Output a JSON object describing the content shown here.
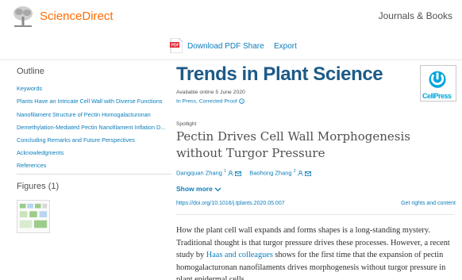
{
  "header": {
    "brand": "ScienceDirect",
    "journals_link": "Journals & Books"
  },
  "toolbar": {
    "download_pdf": "Download PDF",
    "share": "Share",
    "export": "Export"
  },
  "sidebar": {
    "outline_title": "Outline",
    "outline_items": [
      "Keywords",
      "Plants Have an Intricate Cell Wall with Diverse Functions",
      "Nanofilament Structure of Pectin Homogalacturonan",
      "Demethylation-Mediated Pectin Nanofilament Inflation D...",
      "Concluding Remarks and Future Perspectives",
      "Acknowledgments",
      "References"
    ],
    "figures_title": "Figures (1)"
  },
  "article": {
    "journal": "Trends in Plant Science",
    "available": "Available online 5 June 2020",
    "in_press": "In Press, Corrected Proof",
    "publisher_logo": "CellPress",
    "spotlight": "Spotlight",
    "title": "Pectin Drives Cell Wall Morphogenesis without Turgor Pressure",
    "authors": [
      {
        "name": "Dangquan Zhang",
        "sup": "1"
      },
      {
        "name": "Baohong Zhang",
        "sup": "2"
      }
    ],
    "show_more": "Show more",
    "doi": "https://doi.org/10.1016/j.tplants.2020.05.007",
    "rights": "Get rights and content",
    "abstract_before": "How the plant cell wall expands and forms shapes is a long-standing mystery. Traditional thought is that turgor pressure drives these processes. However, a recent study by ",
    "abstract_link": "Haas and colleagues",
    "abstract_after": " shows for the first time that the expansion of pectin homogalacturonan nanofilaments drives morphogenesis without turgor pressure in plant epidermal cells."
  },
  "colors": {
    "brand_orange": "#ff6c00",
    "journal_blue": "#1d5a87",
    "link_blue": "#0c7dbb"
  }
}
